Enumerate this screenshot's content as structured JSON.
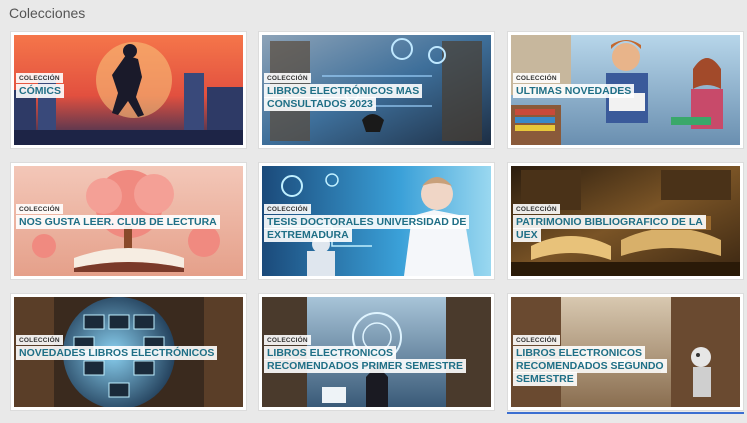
{
  "page": {
    "title": "Colecciones"
  },
  "collections": [
    {
      "badge": "COLECCIÓN",
      "title": "CÓMICS",
      "image_icon": "ninja-city-illustration"
    },
    {
      "badge": "COLECCIÓN",
      "title": "LIBROS ELECTRÓNICOS MAS CONSULTADOS 2023",
      "image_icon": "digital-library-vr"
    },
    {
      "badge": "COLECCIÓN",
      "title": "ULTIMAS NOVEDADES",
      "image_icon": "students-reading"
    },
    {
      "badge": "COLECCIÓN",
      "title": "NOS GUSTA LEER. CLUB DE LECTURA",
      "image_icon": "tree-open-book"
    },
    {
      "badge": "COLECCIÓN",
      "title": "TESIS DOCTORALES UNIVERSIDAD DE EXTREMADURA",
      "image_icon": "scientist-robot"
    },
    {
      "badge": "COLECCIÓN",
      "title": "PATRIMONIO BIBLIOGRAFICO DE LA UEX",
      "image_icon": "old-books"
    },
    {
      "badge": "COLECCIÓN",
      "title": "NOVEDADES LIBROS ELECTRÓNICOS",
      "image_icon": "screen-globe-library"
    },
    {
      "badge": "COLECCIÓN",
      "title": "LIBROS ELECTRONICOS RECOMENDADOS PRIMER SEMESTRE",
      "image_icon": "tech-library-reader"
    },
    {
      "badge": "COLECCIÓN",
      "title": "LIBROS ELECTRONICOS RECOMENDADOS SEGUNDO SEMESTRE",
      "image_icon": "robot-library"
    }
  ]
}
